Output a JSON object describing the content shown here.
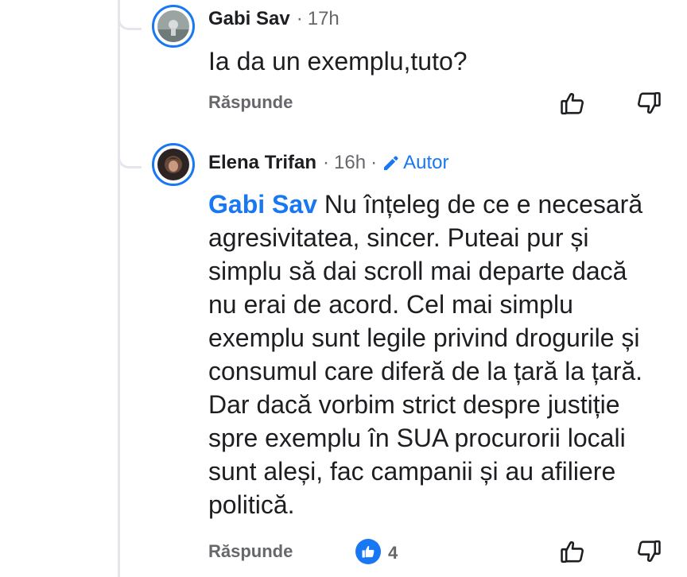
{
  "comments": [
    {
      "author": "Gabi Sav",
      "separator": "·",
      "time": "17h",
      "text": "Ia da un exemplu,tuto?",
      "reply_label": "Răspunde"
    },
    {
      "author": "Elena Trifan",
      "separator": "·",
      "time": "16h",
      "separator2": "·",
      "badge": "Autor",
      "mention": "Gabi Sav",
      "text_lines": [
        " Nu înțeleg de ce e necesară",
        "agresivitatea, sincer. Puteai pur și",
        "simplu să dai scroll mai departe dacă",
        "nu erai de acord. Cel mai simplu",
        "exemplu sunt legile privind drogurile și",
        "consumul care diferă de la țară la țară.",
        "Dar dacă vorbim strict despre justiție",
        "spre exemplu în SUA procurorii locali",
        "sunt aleși, fac campanii și au afiliere",
        "politică."
      ],
      "reply_label": "Răspunde",
      "like_count": "4"
    }
  ],
  "icons": {
    "like": "thumbs-up-icon",
    "dislike": "thumbs-down-icon",
    "author_badge": "pencil-icon",
    "reaction": "like-reaction-icon"
  },
  "colors": {
    "accent": "#1877f2",
    "meta": "#65676b",
    "text": "#1c1e21",
    "thread_line": "#e4e6eb"
  }
}
